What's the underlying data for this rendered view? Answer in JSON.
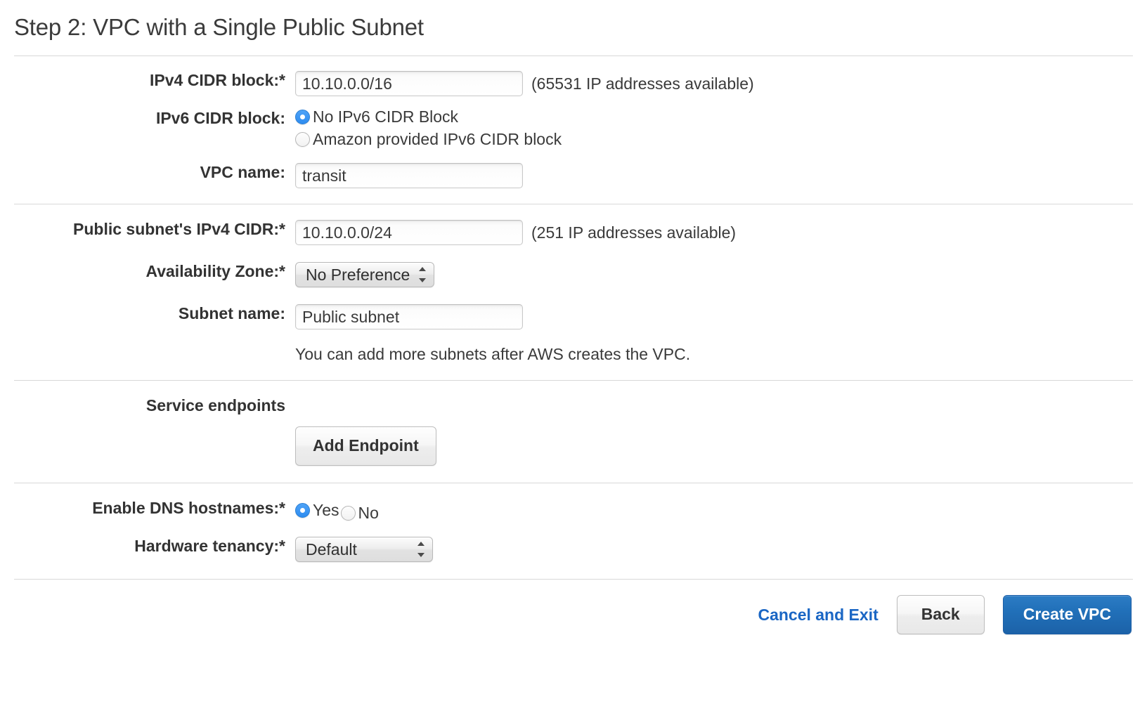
{
  "header": {
    "title": "Step 2: VPC with a Single Public Subnet"
  },
  "vpc_section": {
    "ipv4_cidr": {
      "label": "IPv4 CIDR block:*",
      "value": "10.10.0.0/16",
      "hint": "(65531 IP addresses available)"
    },
    "ipv6_cidr": {
      "label": "IPv6 CIDR block:",
      "options": [
        {
          "label": "No IPv6 CIDR Block",
          "selected": true
        },
        {
          "label": "Amazon provided IPv6 CIDR block",
          "selected": false
        }
      ]
    },
    "vpc_name": {
      "label": "VPC name:",
      "value": "transit"
    }
  },
  "subnet_section": {
    "public_subnet_cidr": {
      "label": "Public subnet's IPv4 CIDR:*",
      "value": "10.10.0.0/24",
      "hint": "(251 IP addresses available)"
    },
    "availability_zone": {
      "label": "Availability Zone:*",
      "selected": "No Preference"
    },
    "subnet_name": {
      "label": "Subnet name:",
      "value": "Public subnet"
    },
    "help_text": "You can add more subnets after AWS creates the VPC."
  },
  "endpoints_section": {
    "label": "Service endpoints",
    "add_endpoint_label": "Add Endpoint"
  },
  "options_section": {
    "dns_hostnames": {
      "label": "Enable DNS hostnames:*",
      "options": [
        {
          "label": "Yes",
          "selected": true
        },
        {
          "label": "No",
          "selected": false
        }
      ]
    },
    "hardware_tenancy": {
      "label": "Hardware tenancy:*",
      "selected": "Default"
    }
  },
  "footer": {
    "cancel_label": "Cancel and Exit",
    "back_label": "Back",
    "create_label": "Create VPC"
  },
  "colors": {
    "primary_blue": "#1c62a8",
    "link_blue": "#1a66c4",
    "radio_blue": "#2d8cf0",
    "divider": "#d8d8d8",
    "text": "#333333"
  }
}
